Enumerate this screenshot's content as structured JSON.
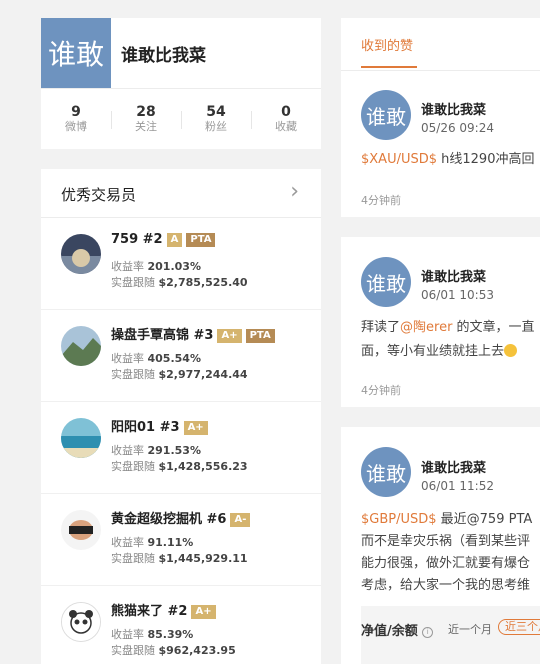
{
  "profile": {
    "avatar_text": "谁敢",
    "name": "谁敢比我菜",
    "stats": [
      {
        "value": "9",
        "label": "微博"
      },
      {
        "value": "28",
        "label": "关注"
      },
      {
        "value": "54",
        "label": "粉丝"
      },
      {
        "value": "0",
        "label": "收藏"
      }
    ]
  },
  "traders": {
    "title": "优秀交易员",
    "items": [
      {
        "name": "759 #2",
        "badges": [
          "A",
          "PTA"
        ],
        "yield_label": "收益率",
        "yield": "201.03%",
        "follow_label": "实盘跟随",
        "follow": "$2,785,525.40"
      },
      {
        "name": "操盘手覃高锦 #3",
        "badges": [
          "A+",
          "PTA"
        ],
        "yield_label": "收益率",
        "yield": "405.54%",
        "follow_label": "实盘跟随",
        "follow": "$2,977,244.44"
      },
      {
        "name": "阳阳01 #3",
        "badges": [
          "A+"
        ],
        "yield_label": "收益率",
        "yield": "291.53%",
        "follow_label": "实盘跟随",
        "follow": "$1,428,556.23"
      },
      {
        "name": "黄金超级挖掘机 #6",
        "badges": [
          "A-"
        ],
        "yield_label": "收益率",
        "yield": "91.11%",
        "follow_label": "实盘跟随",
        "follow": "$1,445,929.11"
      },
      {
        "name": "熊猫来了 #2",
        "badges": [
          "A+"
        ],
        "yield_label": "收益率",
        "yield": "85.39%",
        "follow_label": "实盘跟随",
        "follow": "$962,423.95"
      }
    ]
  },
  "feed": {
    "tab": "收到的赞",
    "posts": [
      {
        "avatar_text": "谁敢",
        "user": "谁敢比我菜",
        "time": "05/26 09:24",
        "tag": "$XAU/USD$",
        "text": " h线1290冲高回",
        "meta": "4分钟前"
      },
      {
        "avatar_text": "谁敢",
        "user": "谁敢比我菜",
        "time": "06/01 10:53",
        "line1_pre": "拜读了",
        "mention": "@陶erer",
        "line1_post": " 的文章，一直",
        "line2": "面，等小有业绩就挂上去",
        "meta": "4分钟前"
      },
      {
        "avatar_text": "谁敢",
        "user": "谁敢比我菜",
        "time": "06/01 11:52",
        "tag": "$GBP/USD$",
        "line1_post": " 最近@759 PTA",
        "line2": "而不是幸灾乐祸（看到某些评",
        "line3": "能力很强，做外汇就要有爆仓",
        "line4": "考虑，给大家一个我的思考维"
      }
    ],
    "netvalue_label": "净值/余额",
    "period1": "近一个月",
    "period2": "近三个月"
  },
  "colors": {
    "accent": "#e07a3a",
    "avatar": "#6e93bf",
    "badge_gold": "#d5b46e",
    "badge_pta": "#b58b55"
  }
}
